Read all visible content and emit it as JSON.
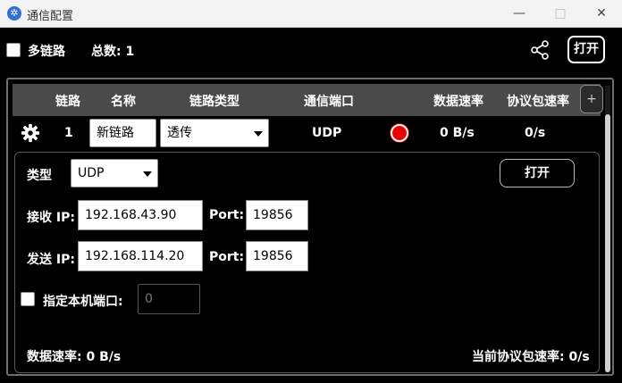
{
  "window": {
    "title": "通信配置",
    "app_icon": "app-logo-icon",
    "min_icon": "—",
    "max_icon": "□",
    "close_icon": "✕"
  },
  "toolbar": {
    "multi_link_label": "多链路",
    "multi_link_checked": false,
    "total_label": "总数: 1",
    "share_icon": "share-icon",
    "open_label": "打开"
  },
  "table": {
    "headers": [
      "链路",
      "名称",
      "链路类型",
      "通信端口",
      "数据速率",
      "协议包速率"
    ],
    "add_label": "+",
    "rows": [
      {
        "index": "1",
        "name": "新链路",
        "link_type": "透传",
        "port": "UDP",
        "status_color": "#ee0000",
        "data_rate": "0 B/s",
        "packet_rate": "0/s"
      }
    ]
  },
  "detail": {
    "type_label": "类型",
    "type_value": "UDP",
    "open_label": "打开",
    "recv_ip_label": "接收 IP:",
    "recv_ip": "192.168.43.90",
    "recv_port_label": "Port:",
    "recv_port": "19856",
    "send_ip_label": "发送 IP:",
    "send_ip": "192.168.114.20",
    "send_port_label": "Port:",
    "send_port": "19856",
    "local_port_label": "指定本机端口:",
    "local_port_checked": false,
    "local_port_value": "0",
    "data_rate_footer": "数据速率: 0 B/s",
    "packet_rate_footer": "当前协议包速率: 0/s"
  }
}
